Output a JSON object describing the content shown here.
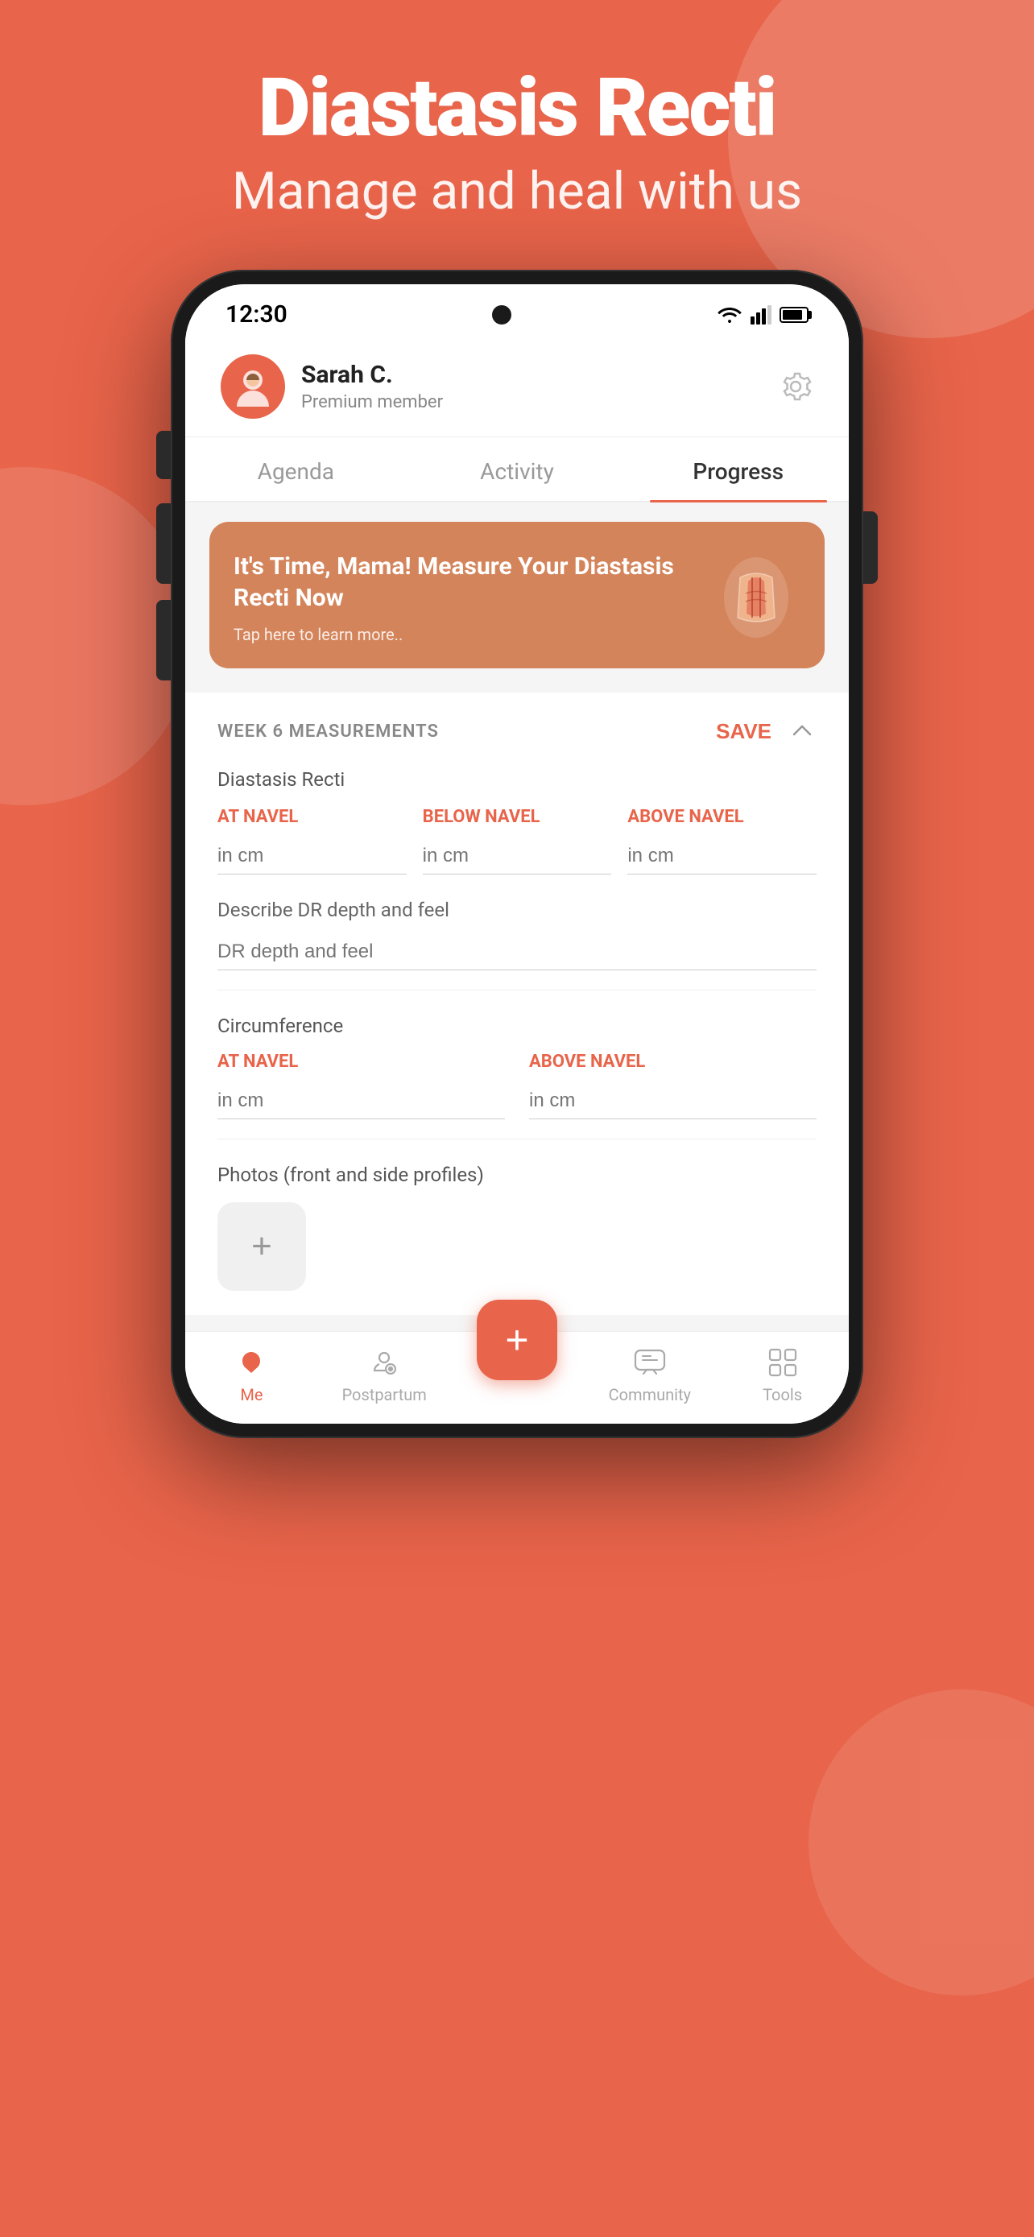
{
  "app": {
    "title": "Diastasis Recti",
    "subtitle": "Manage and heal with us"
  },
  "status_bar": {
    "time": "12:30"
  },
  "user": {
    "name": "Sarah C.",
    "role": "Premium member"
  },
  "tabs": [
    {
      "id": "agenda",
      "label": "Agenda",
      "active": false
    },
    {
      "id": "activity",
      "label": "Activity",
      "active": false
    },
    {
      "id": "progress",
      "label": "Progress",
      "active": true
    }
  ],
  "banner": {
    "title": "It's Time, Mama! Measure Your Diastasis Recti Now",
    "subtitle": "Tap here to learn more.."
  },
  "measurements": {
    "section_title": "WEEK 6 MEASUREMENTS",
    "save_label": "SAVE",
    "diastasis_label": "Diastasis Recti",
    "columns": [
      {
        "id": "at-navel",
        "label": "AT NAVEL",
        "placeholder": "in cm"
      },
      {
        "id": "below-navel",
        "label": "BELOW NAVEL",
        "placeholder": "in cm"
      },
      {
        "id": "above-navel",
        "label": "ABOVE NAVEL",
        "placeholder": "in cm"
      }
    ],
    "describe_label": "Describe DR depth and feel",
    "describe_placeholder": "DR depth and feel",
    "circumference_label": "Circumference",
    "circ_cols": [
      {
        "id": "circ-at-navel",
        "label": "AT NAVEL",
        "placeholder": "in cm"
      },
      {
        "id": "circ-above-navel",
        "label": "ABOVE NAVEL",
        "placeholder": "in cm"
      }
    ],
    "photos_label": "Photos (front and side profiles)"
  },
  "nav": {
    "items": [
      {
        "id": "me",
        "label": "Me",
        "active": true
      },
      {
        "id": "postpartum",
        "label": "Postpartum",
        "active": false
      },
      {
        "id": "fab",
        "label": "+",
        "active": false
      },
      {
        "id": "community",
        "label": "Community",
        "active": false
      },
      {
        "id": "tools",
        "label": "Tools",
        "active": false
      }
    ]
  },
  "colors": {
    "primary": "#e8644a",
    "bg_orange": "#E8644A",
    "banner_bg": "#d4845a",
    "inactive_nav": "#aaa"
  }
}
